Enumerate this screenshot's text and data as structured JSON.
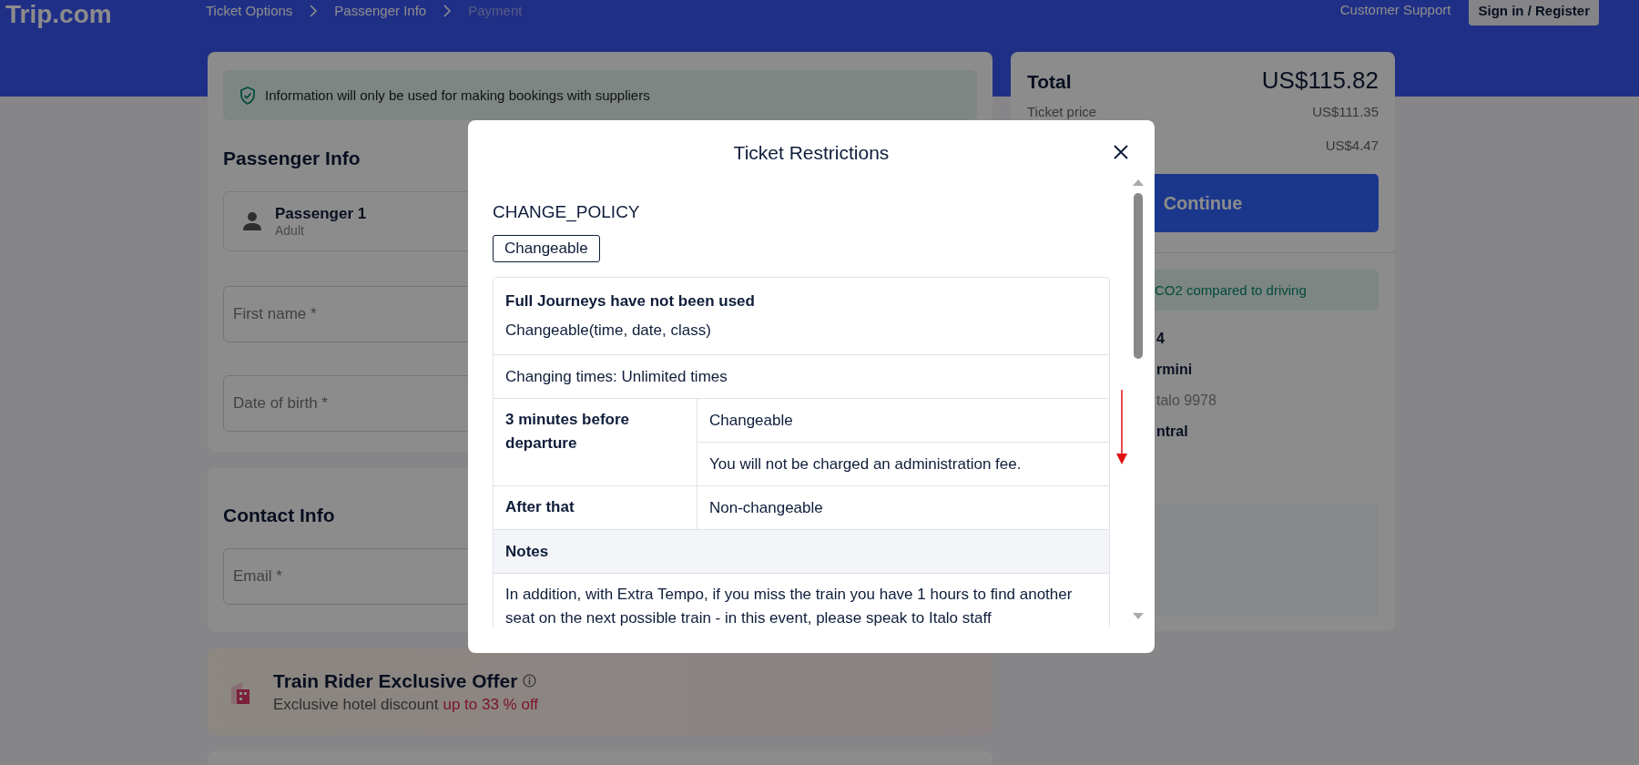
{
  "header": {
    "logo": "Trip.com",
    "breadcrumbs": [
      {
        "label": "Ticket Options",
        "disabled": false
      },
      {
        "label": "Passenger Info",
        "disabled": false
      },
      {
        "label": "Payment",
        "disabled": true
      }
    ],
    "support": "Customer Support",
    "sign_in": "Sign in / Register"
  },
  "notice": "Information will only be used for making bookings with suppliers",
  "passenger_section": {
    "title": "Passenger Info",
    "passenger": {
      "name": "Passenger 1",
      "type": "Adult"
    },
    "fields": [
      {
        "placeholder": "First name *"
      },
      {
        "placeholder": "Date of birth *"
      }
    ]
  },
  "contact_section": {
    "title": "Contact Info",
    "fields": [
      {
        "placeholder": "Email *"
      }
    ]
  },
  "offer": {
    "title": "Train Rider Exclusive Offer",
    "subtitle": "Exclusive hotel discount",
    "highlight": "up to 33 % off"
  },
  "summary": {
    "total_label": "Total",
    "total": "US$115.82",
    "lines": [
      {
        "label": "Ticket price",
        "value": "US$111.35"
      },
      {
        "value": "US$4.47"
      }
    ],
    "button": "Continue",
    "eco": "CO2 compared to driving",
    "fragments": [
      {
        "text": "4",
        "kind": "bold"
      },
      {
        "text": "rmini",
        "kind": "bold"
      },
      {
        "text": "talo 9978",
        "kind": "muted"
      },
      {
        "text": "ntral",
        "kind": "bold"
      }
    ]
  },
  "modal": {
    "title": "Ticket Restrictions",
    "section": "CHANGE_POLICY",
    "tag": "Changeable",
    "rows": [
      {
        "kind": "full",
        "title": "Full Journeys have not been used",
        "text": "Changeable(time, date, class)"
      },
      {
        "kind": "full",
        "text": "Changing times: Unlimited times"
      },
      {
        "kind": "split",
        "label": "3 minutes before departure",
        "values": [
          "Changeable",
          "You will not be charged an administration fee."
        ]
      },
      {
        "kind": "split",
        "label": "After that",
        "values": [
          "Non-changeable"
        ]
      },
      {
        "kind": "header",
        "label": "Notes"
      },
      {
        "kind": "full",
        "text": "In addition, with Extra Tempo, if you miss the train you have 1 hours to find another seat on the next possible train - in this event, please speak to Italo staff"
      }
    ]
  }
}
